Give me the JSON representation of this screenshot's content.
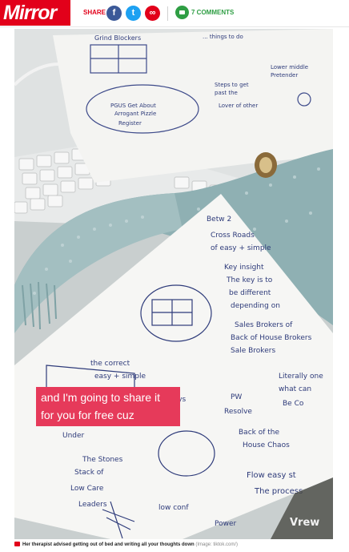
{
  "header": {
    "logo_text": "Mirror",
    "share_label": "SHARE",
    "social": {
      "facebook_icon": "f",
      "twitter_icon": "t",
      "link_icon": "∞"
    },
    "comments_label": "7 COMMENTS"
  },
  "video": {
    "caption_text": "and I'm going to share it for you for free cuz",
    "watermark": "Vrew"
  },
  "photo_caption": {
    "text": "Her therapist advised getting out of bed and writing all your thoughts down",
    "credit": "(Image: tiktok.com/)"
  },
  "colors": {
    "brand": "#e2001a",
    "caption_bubble": "#e63a5a",
    "comments": "#2f9e44"
  }
}
